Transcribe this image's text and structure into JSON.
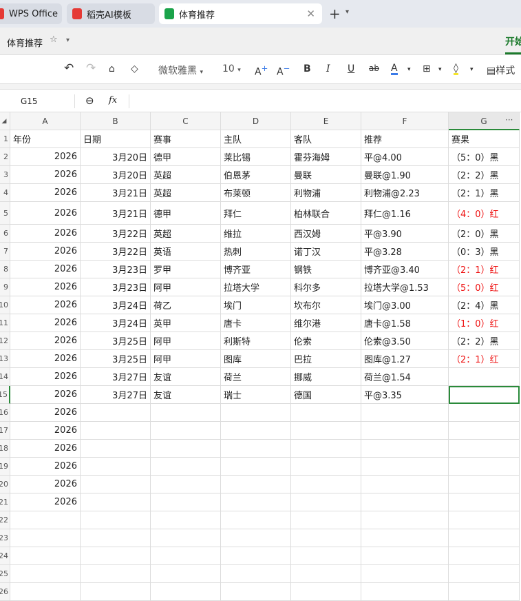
{
  "tabs": [
    {
      "label": "WPS Office",
      "icon": "wps-icon",
      "color": "#e53935"
    },
    {
      "label": "稻壳AI模板",
      "icon": "docer-icon",
      "color": "#e53935"
    },
    {
      "label": "体育推荐",
      "icon": "spreadsheet-icon",
      "color": "#1aa34a",
      "active": true
    }
  ],
  "title": {
    "doc": "体育推荐",
    "start_tab": "开始"
  },
  "toolbar": {
    "font": "微软雅黑",
    "size": "10",
    "style": "样式",
    "font_color": "#3b7be8",
    "fill_color": "#f5e52a"
  },
  "formula": {
    "cell_ref": "G15",
    "value": ""
  },
  "columns": [
    "A",
    "B",
    "C",
    "D",
    "E",
    "F",
    "G"
  ],
  "headers": [
    "年份",
    "日期",
    "赛事",
    "主队",
    "客队",
    "推荐",
    "赛果"
  ],
  "rows": [
    {
      "n": "2",
      "c": [
        "2026",
        "3月20日",
        "德甲",
        "莱比锡",
        "霍芬海姆",
        "平@4.00",
        "（5：0）黑"
      ],
      "red": false
    },
    {
      "n": "3",
      "c": [
        "2026",
        "3月20日",
        "英超",
        "伯恩茅",
        "曼联",
        "曼联@1.90",
        "（2：2）黑"
      ],
      "red": false
    },
    {
      "n": "4",
      "c": [
        "2026",
        "3月21日",
        "英超",
        "布莱顿",
        "利物浦",
        "利物浦@2.23",
        "（2：1）黑"
      ],
      "red": false
    },
    {
      "n": "5",
      "c": [
        "2026",
        "3月21日",
        "德甲",
        "拜仁",
        "柏林联合",
        "拜仁@1.16",
        "（4：0）红"
      ],
      "red": true
    },
    {
      "n": "6",
      "c": [
        "2026",
        "3月22日",
        "英超",
        "维拉",
        "西汉姆",
        "平@3.90",
        "（2：0）黑"
      ],
      "red": false
    },
    {
      "n": "7",
      "c": [
        "2026",
        "3月22日",
        "英语",
        "热刺",
        "诺丁汉",
        "平@3.28",
        "（0：3）黑"
      ],
      "red": false
    },
    {
      "n": "8",
      "c": [
        "2026",
        "3月23日",
        "罗甲",
        "博齐亚",
        "钢铁",
        "博齐亚@3.40",
        "（2：1）红"
      ],
      "red": true
    },
    {
      "n": "9",
      "c": [
        "2026",
        "3月23日",
        "阿甲",
        "拉塔大学",
        "科尔多",
        "拉塔大学@1.53",
        "（5：0）红"
      ],
      "red": true
    },
    {
      "n": "10",
      "c": [
        "2026",
        "3月24日",
        "荷乙",
        "埃门",
        "坎布尔",
        "埃门@3.00",
        "（2：4）黑"
      ],
      "red": false
    },
    {
      "n": "11",
      "c": [
        "2026",
        "3月24日",
        "英甲",
        "唐卡",
        "维尔港",
        "唐卡@1.58",
        "（1：0）红"
      ],
      "red": true
    },
    {
      "n": "12",
      "c": [
        "2026",
        "3月25日",
        "阿甲",
        "利斯特",
        "伦索",
        "伦索@3.50",
        "（2：2）黑"
      ],
      "red": false
    },
    {
      "n": "13",
      "c": [
        "2026",
        "3月25日",
        "阿甲",
        "图库",
        "巴拉",
        "图库@1.27",
        "（2：1）红"
      ],
      "red": true
    },
    {
      "n": "14",
      "c": [
        "2026",
        "3月27日",
        "友谊",
        "荷兰",
        "挪威",
        "荷兰@1.54",
        ""
      ],
      "red": false
    },
    {
      "n": "15",
      "c": [
        "2026",
        "3月27日",
        "友谊",
        "瑞士",
        "德国",
        "平@3.35",
        ""
      ],
      "red": false
    },
    {
      "n": "16",
      "c": [
        "2026",
        "",
        "",
        "",
        "",
        "",
        ""
      ],
      "red": false
    },
    {
      "n": "17",
      "c": [
        "2026",
        "",
        "",
        "",
        "",
        "",
        ""
      ],
      "red": false
    },
    {
      "n": "18",
      "c": [
        "2026",
        "",
        "",
        "",
        "",
        "",
        ""
      ],
      "red": false
    },
    {
      "n": "19",
      "c": [
        "2026",
        "",
        "",
        "",
        "",
        "",
        ""
      ],
      "red": false
    },
    {
      "n": "20",
      "c": [
        "2026",
        "",
        "",
        "",
        "",
        "",
        ""
      ],
      "red": false
    },
    {
      "n": "21",
      "c": [
        "2026",
        "",
        "",
        "",
        "",
        "",
        ""
      ],
      "red": false
    },
    {
      "n": "22",
      "c": [
        "",
        "",
        "",
        "",
        "",
        "",
        ""
      ],
      "red": false
    },
    {
      "n": "23",
      "c": [
        "",
        "",
        "",
        "",
        "",
        "",
        ""
      ],
      "red": false
    },
    {
      "n": "24",
      "c": [
        "",
        "",
        "",
        "",
        "",
        "",
        ""
      ],
      "red": false
    },
    {
      "n": "25",
      "c": [
        "",
        "",
        "",
        "",
        "",
        "",
        ""
      ],
      "red": false
    },
    {
      "n": "26",
      "c": [
        "",
        "",
        "",
        "",
        "",
        "",
        ""
      ],
      "red": false
    }
  ],
  "selected": {
    "row": "15",
    "col": "G"
  }
}
